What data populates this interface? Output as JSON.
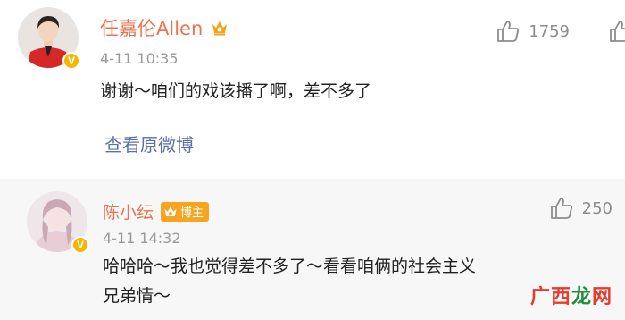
{
  "comments": [
    {
      "username": "任嘉伦Allen",
      "verified_badge": "V",
      "time": "4-11 10:35",
      "text": "谢谢～咱们的戏该播了啊，差不多了",
      "view_original": "查看原微博",
      "likes": "1759",
      "name_color": "#eb7350"
    },
    {
      "username": "陈小纭",
      "badge_label": "博主",
      "verified_badge": "V",
      "time": "4-11 14:32",
      "text_line1": "哈哈哈～我也觉得差不多了～看看咱俩的社会主义",
      "text_line2": "兄弟情～",
      "likes": "250"
    }
  ],
  "watermark": {
    "part1": "广西",
    "part2": "龙",
    "part3": "网"
  },
  "colors": {
    "link": "#5b6fa8",
    "badge": "#f7a520",
    "secondary": "#999999"
  }
}
